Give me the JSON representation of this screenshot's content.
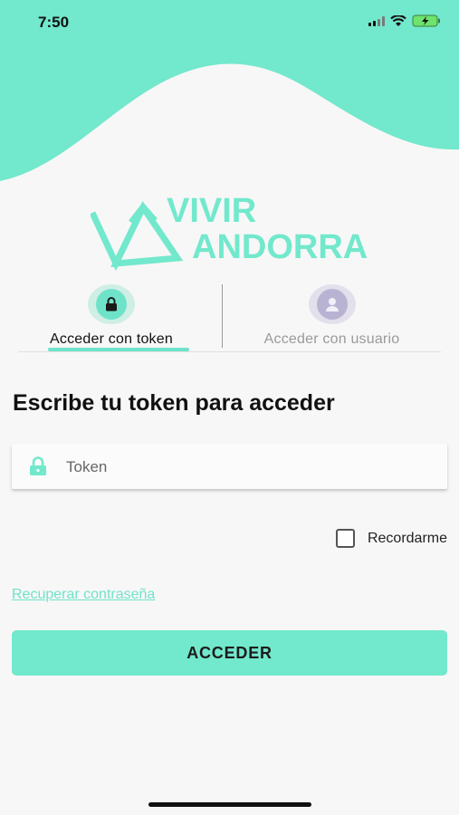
{
  "status_bar": {
    "time": "7:50"
  },
  "logo": {
    "line1": "VIVIR",
    "line2": "ANDORRA"
  },
  "tabs": [
    {
      "label": "Acceder con token",
      "icon": "lock-icon",
      "active": true
    },
    {
      "label": "Acceder con usuario",
      "icon": "user-icon",
      "active": false
    }
  ],
  "heading": "Escribe tu token para acceder",
  "token_field": {
    "placeholder": "Token",
    "value": ""
  },
  "remember": {
    "label": "Recordarme",
    "checked": false
  },
  "recover_link": "Recuperar contraseña",
  "submit_label": "ACCEDER",
  "colors": {
    "accent": "#72e8cc",
    "background": "#f7f7f7",
    "muted": "#9a9a9a"
  }
}
